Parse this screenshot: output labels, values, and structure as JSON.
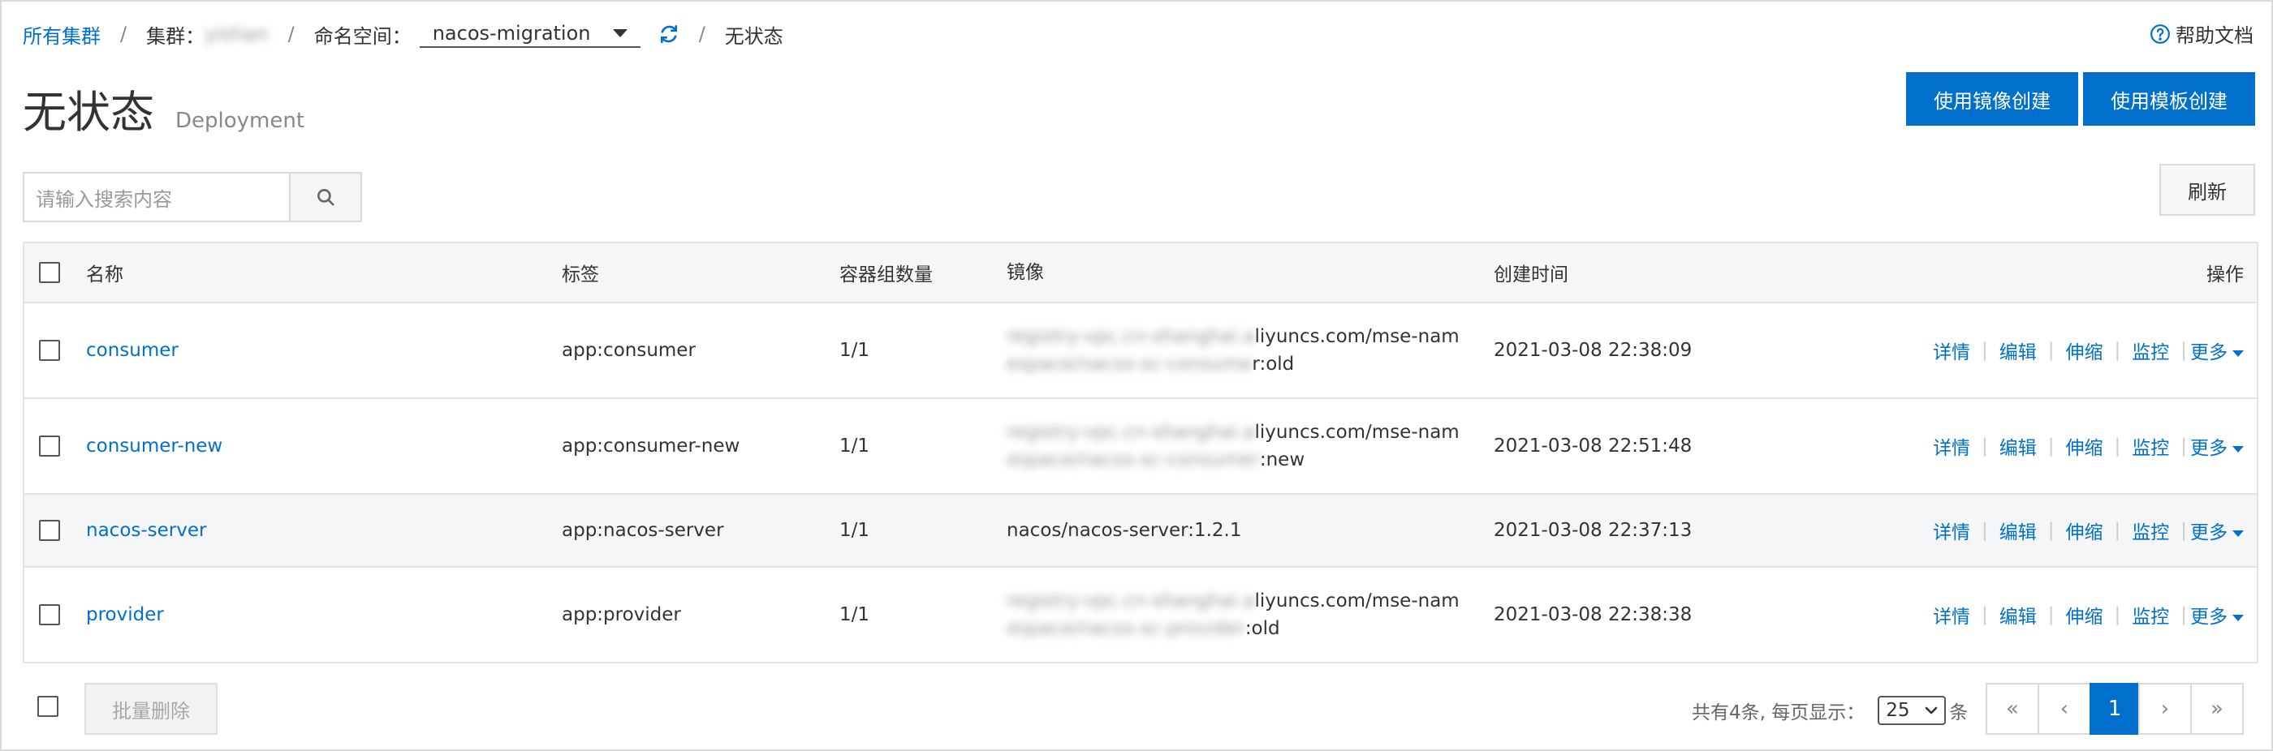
{
  "breadcrumb": {
    "all_clusters": "所有集群",
    "sep": "/",
    "cluster_label": "集群：",
    "cluster_value": "yishan",
    "namespace_label": "命名空间：",
    "namespace_value": "nacos-migration",
    "current": "无状态"
  },
  "help": {
    "label": "帮助文档"
  },
  "header": {
    "title": "无状态",
    "subtitle": "Deployment",
    "create_image_label": "使用镜像创建",
    "create_template_label": "使用模板创建"
  },
  "search": {
    "placeholder": "请输入搜索内容"
  },
  "refresh_label": "刷新",
  "table": {
    "columns": [
      "名称",
      "标签",
      "容器组数量",
      "镜像",
      "创建时间",
      "操作"
    ],
    "ops": [
      "详情",
      "编辑",
      "伸缩",
      "监控",
      "更多"
    ],
    "rows": [
      {
        "name": "consumer",
        "label": "app:consumer",
        "pods": "1/1",
        "image_blur_1": "registry-vpc.cn-shanghai.a",
        "image_vis_1": "liyuncs.com/mse-nam",
        "image_blur_2": "espace/nacos-sc-consume",
        "image_vis_2": "r:old",
        "created": "2021-03-08 22:38:09"
      },
      {
        "name": "consumer-new",
        "label": "app:consumer-new",
        "pods": "1/1",
        "image_blur_1": "registry-vpc.cn-shanghai.a",
        "image_vis_1": "liyuncs.com/mse-nam",
        "image_blur_2": "espace/nacos-sc-consumer",
        "image_vis_2": ":new",
        "created": "2021-03-08 22:51:48"
      },
      {
        "name": "nacos-server",
        "label": "app:nacos-server",
        "pods": "1/1",
        "image": "nacos/nacos-server:1.2.1",
        "created": "2021-03-08 22:37:13"
      },
      {
        "name": "provider",
        "label": "app:provider",
        "pods": "1/1",
        "image_blur_1": "registry-vpc.cn-shanghai.a",
        "image_vis_1": "liyuncs.com/mse-nam",
        "image_blur_2": "espace/nacos-sc-provider",
        "image_vis_2": ":old",
        "created": "2021-03-08 22:38:38"
      }
    ]
  },
  "footer": {
    "batch_delete_label": "批量删除",
    "total_text": "共有4条, 每页显示：",
    "page_size": "25",
    "unit": "条",
    "pager": {
      "first": "«",
      "prev": "‹",
      "current": "1",
      "next": "›",
      "last": "»"
    }
  },
  "colors": {
    "primary": "#0070cc",
    "border": "#d9d9d9",
    "header_bg": "#f5f6f8"
  },
  "icons": {
    "refresh": "refresh-icon",
    "help": "help-circle-icon",
    "search": "search-icon"
  }
}
